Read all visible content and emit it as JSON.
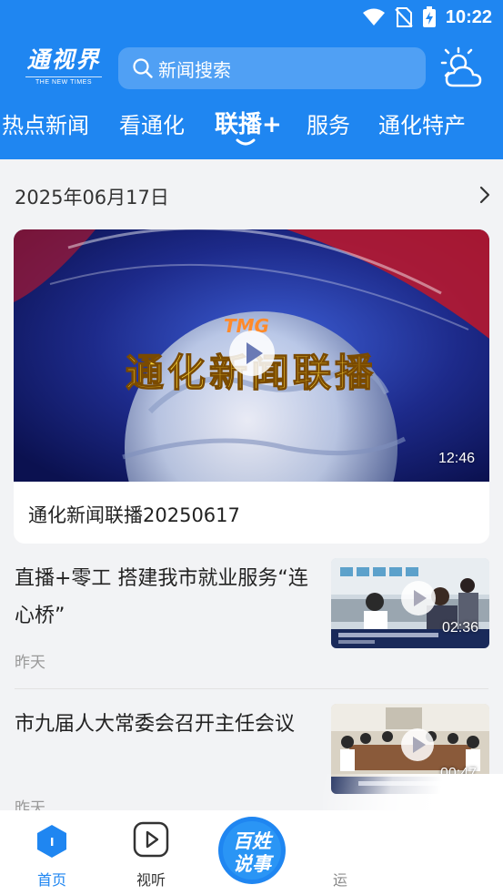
{
  "status_bar": {
    "time": "10:22"
  },
  "logo": {
    "main": "通视界",
    "sub": "THE NEW TIMES"
  },
  "search": {
    "placeholder": "新闻搜索"
  },
  "tabs": [
    {
      "label": "热点新闻"
    },
    {
      "label": "看通化"
    },
    {
      "label": "联播+"
    },
    {
      "label": "服务"
    },
    {
      "label": "通化特产"
    }
  ],
  "active_tab": "联播+",
  "date_header": "2025年06月17日",
  "featured": {
    "logo_text": "TMG",
    "banner_text": "通化新闻联播",
    "duration": "12:46",
    "title": "通化新闻联播20250617"
  },
  "news": [
    {
      "title": "直播+零工 搭建我市就业服务“连心桥”",
      "time": "昨天",
      "duration": "02:36"
    },
    {
      "title": "市九届人大常委会召开主任会议",
      "time": "昨天",
      "duration": "00:47"
    }
  ],
  "bottom_nav": {
    "home": "首页",
    "video": "视听",
    "center_line1": "百姓",
    "center_line2": "说事",
    "partial": "运"
  },
  "colors": {
    "brand": "#1f86f1",
    "active_nav": "#1f86f1",
    "text_dark": "#222222",
    "text_muted": "#999999"
  }
}
